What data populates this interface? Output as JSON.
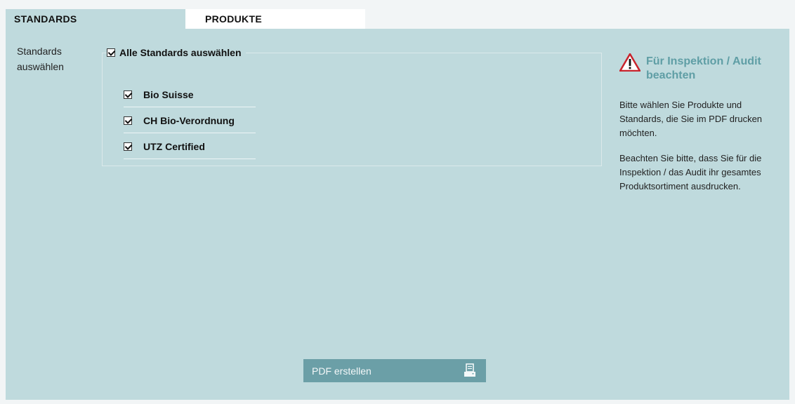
{
  "tabs": [
    {
      "label": "STANDARDS",
      "active": true
    },
    {
      "label": "PRODUKTE",
      "active": false
    }
  ],
  "form": {
    "side_label": "Standards auswählen",
    "select_all": {
      "label": "Alle Standards auswählen",
      "checked": true
    },
    "options": [
      {
        "label": "Bio Suisse",
        "checked": true
      },
      {
        "label": "CH Bio-Verordnung",
        "checked": true
      },
      {
        "label": "UTZ Certified",
        "checked": true
      }
    ]
  },
  "aside": {
    "icon": "warning-triangle-icon",
    "title": "Für Inspektion / Audit beachten",
    "text1": "Bitte wählen Sie Produkte und Standards, die Sie im PDF drucken möchten.",
    "text2": "Beachten Sie bitte, dass Sie für die Inspektion / das Audit ihr gesamtes Produktsortiment ausdrucken."
  },
  "actions": {
    "pdf_label": "PDF erstellen",
    "pdf_icon": "printer-icon"
  },
  "colors": {
    "panel": "#bfdadd",
    "accent": "#5f9ea5",
    "button": "#6b9fa7",
    "warning": "#c8232c"
  }
}
